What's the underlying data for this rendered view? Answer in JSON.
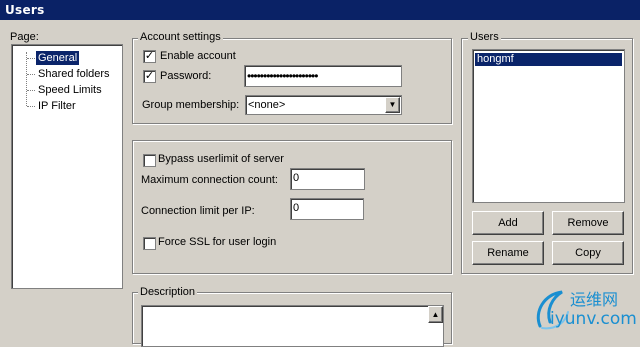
{
  "window": {
    "title": "Users"
  },
  "page_nav": {
    "label": "Page:",
    "items": [
      "General",
      "Shared folders",
      "Speed Limits",
      "IP Filter"
    ],
    "selected_index": 0
  },
  "account_settings": {
    "legend": "Account settings",
    "enable_account_label": "Enable account",
    "enable_account_checked": true,
    "password_label": "Password:",
    "password_checked": true,
    "password_value": "••••••••••••••••••••••",
    "group_label": "Group membership:",
    "group_value": "<none>"
  },
  "limits": {
    "bypass_label": "Bypass userlimit of server",
    "bypass_checked": false,
    "max_conn_label": "Maximum connection count:",
    "max_conn_value": "0",
    "per_ip_label": "Connection limit per IP:",
    "per_ip_value": "0",
    "force_ssl_label": "Force SSL for user login",
    "force_ssl_checked": false
  },
  "description": {
    "legend": "Description",
    "value": ""
  },
  "users": {
    "legend": "Users",
    "list": [
      "hongmf"
    ],
    "selected_index": 0,
    "add_label": "Add",
    "remove_label": "Remove",
    "rename_label": "Rename",
    "copy_label": "Copy"
  },
  "watermark": {
    "text_cn": "运维网",
    "url": "iyunv.com",
    "color": "#1a8fd1"
  }
}
